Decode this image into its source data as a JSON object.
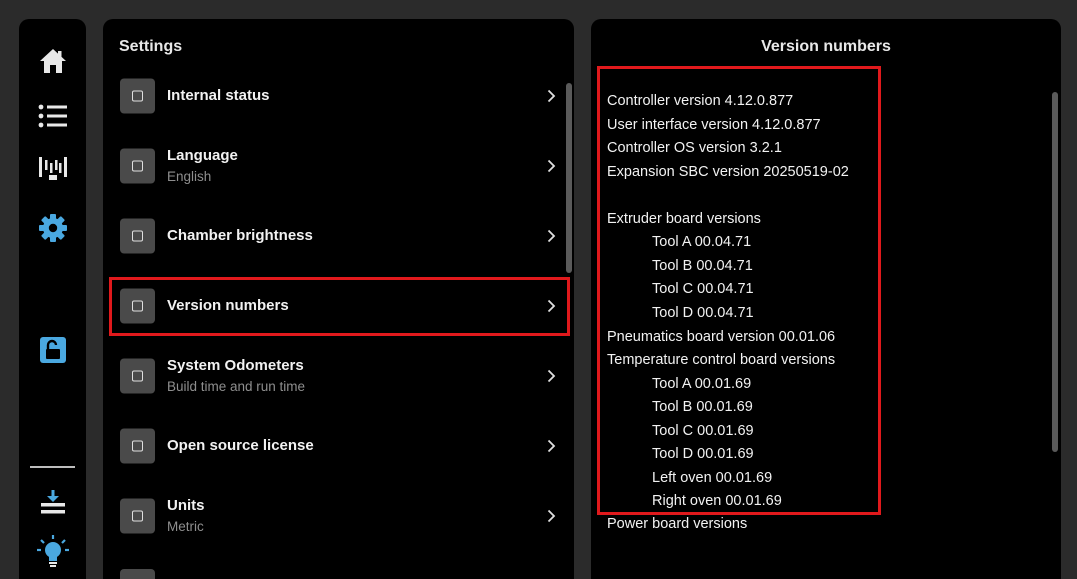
{
  "nav": {
    "items": [
      {
        "name": "home-icon"
      },
      {
        "name": "list-icon"
      },
      {
        "name": "print-queue-icon"
      },
      {
        "name": "gear-icon",
        "active": true
      },
      {
        "name": "lock-open-icon"
      },
      {
        "name": "download-icon"
      },
      {
        "name": "lightbulb-icon"
      }
    ],
    "active_color": "#4aa8e0"
  },
  "settings": {
    "title": "Settings",
    "items": [
      {
        "label": "Internal status",
        "sub": ""
      },
      {
        "label": "Language",
        "sub": "English"
      },
      {
        "label": "Chamber brightness",
        "sub": ""
      },
      {
        "label": "Version numbers",
        "sub": "",
        "selected": true
      },
      {
        "label": "System Odometers",
        "sub": "Build time and run time"
      },
      {
        "label": "Open source license",
        "sub": ""
      },
      {
        "label": "Units",
        "sub": "Metric"
      }
    ]
  },
  "version_panel": {
    "title": "Version numbers",
    "lines": [
      "Controller version 4.12.0.877",
      "User interface version 4.12.0.877",
      "Controller OS version 3.2.1",
      "Expansion SBC version 20250519-02",
      "",
      "Extruder board versions",
      "Tool A 00.04.71",
      "Tool B 00.04.71",
      "Tool C 00.04.71",
      "Tool D 00.04.71",
      "Pneumatics board version 00.01.06",
      "Temperature control board versions",
      "Tool A 00.01.69",
      "Tool B 00.01.69",
      "Tool C 00.01.69",
      "Tool D 00.01.69",
      "Left oven 00.01.69",
      "Right oven 00.01.69",
      "Power board versions"
    ]
  },
  "colors": {
    "highlight": "#e0191c",
    "panel_bg": "#000000",
    "screen_bg": "#2b2b2b"
  }
}
